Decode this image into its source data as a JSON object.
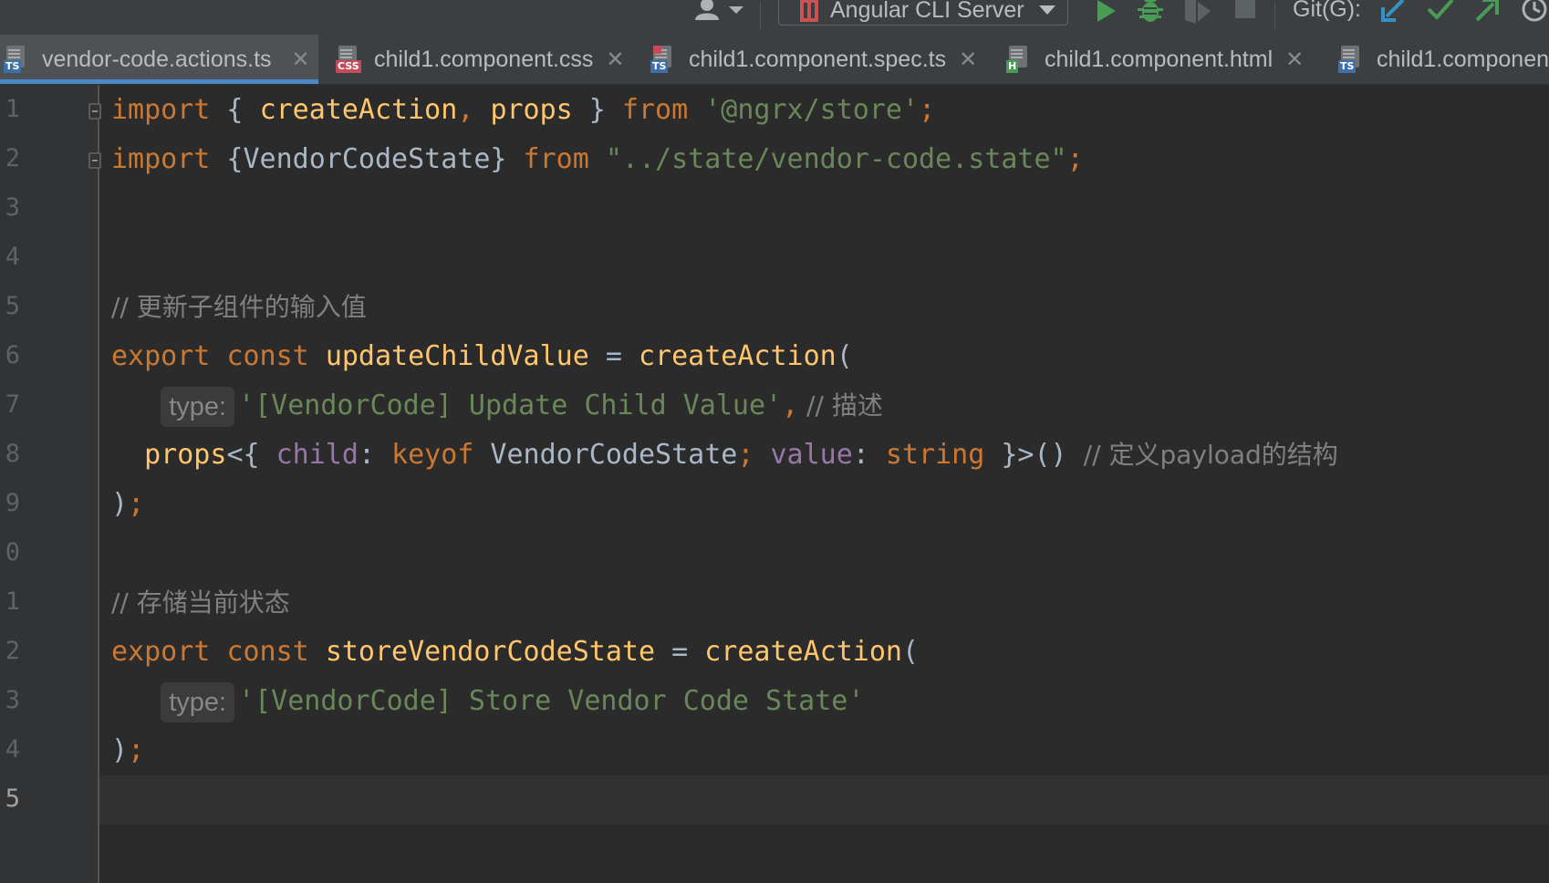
{
  "toolbar": {
    "run_config_label": "Angular CLI Server",
    "git_label": "Git(G):",
    "colors": {
      "run": "#499c54",
      "debug": "#499c54",
      "update": "#3592c4",
      "commit": "#499c54",
      "push": "#499c54"
    }
  },
  "tabs": [
    {
      "label": "vendor-code.actions.ts",
      "badge": "TS",
      "active": true
    },
    {
      "label": "child1.component.css",
      "badge": "CSS",
      "active": false
    },
    {
      "label": "child1.component.spec.ts",
      "badge": "TS",
      "active": false
    },
    {
      "label": "child1.component.html",
      "badge": "H",
      "active": false
    },
    {
      "label": "child1.componen",
      "badge": "TS",
      "active": false
    }
  ],
  "editor": {
    "line_numbers": [
      "1",
      "2",
      "3",
      "4",
      "5",
      "6",
      "7",
      "8",
      "9",
      "0",
      "1",
      "2",
      "3",
      "4",
      "5"
    ],
    "current_line_index": 14,
    "lines": {
      "l1": {
        "import": "import",
        "open": " { ",
        "fn1": "createAction",
        "comma": ",",
        "sp": " ",
        "fn2": "props",
        "close": " } ",
        "from": "from",
        "sp2": " ",
        "str": "'@ngrx/store'",
        "semi": ";"
      },
      "l2": {
        "import": "import",
        "body": " {VendorCodeState} ",
        "from": "from",
        "sp": " ",
        "str": "\"../state/vendor-code.state\"",
        "semi": ";"
      },
      "l5": {
        "comment": "// 更新子组件的输入值"
      },
      "l6": {
        "export": "export",
        "sp": " ",
        "const": "const",
        "sp2": " ",
        "name": "updateChildValue",
        "eq": " = ",
        "fn": "createAction",
        "paren": "("
      },
      "l7": {
        "indent": "   ",
        "hint": "type:",
        "str": "'[VendorCode] Update Child Value'",
        "comma": ",",
        "comment": " // 描述"
      },
      "l8": {
        "indent": "  ",
        "fn": "props",
        "lt": "<{ ",
        "prop1": "child",
        "colon1": ": ",
        "keyof": "keyof",
        "type1": " VendorCodeState",
        "semi1": ";",
        "sp": " ",
        "prop2": "value",
        "colon2": ": ",
        "string": "string",
        "end": " }>() ",
        "comment": "// 定义payload的结构"
      },
      "l9": {
        "paren": ")",
        "semi": ";"
      },
      "l11": {
        "comment": "// 存储当前状态"
      },
      "l12": {
        "export": "export",
        "sp": " ",
        "const": "const",
        "sp2": " ",
        "name": "storeVendorCodeState",
        "eq": " = ",
        "fn": "createAction",
        "paren": "("
      },
      "l13": {
        "indent": "   ",
        "hint": "type:",
        "str": "'[VendorCode] Store Vendor Code State'"
      },
      "l14": {
        "paren": ")",
        "semi": ";"
      }
    }
  }
}
